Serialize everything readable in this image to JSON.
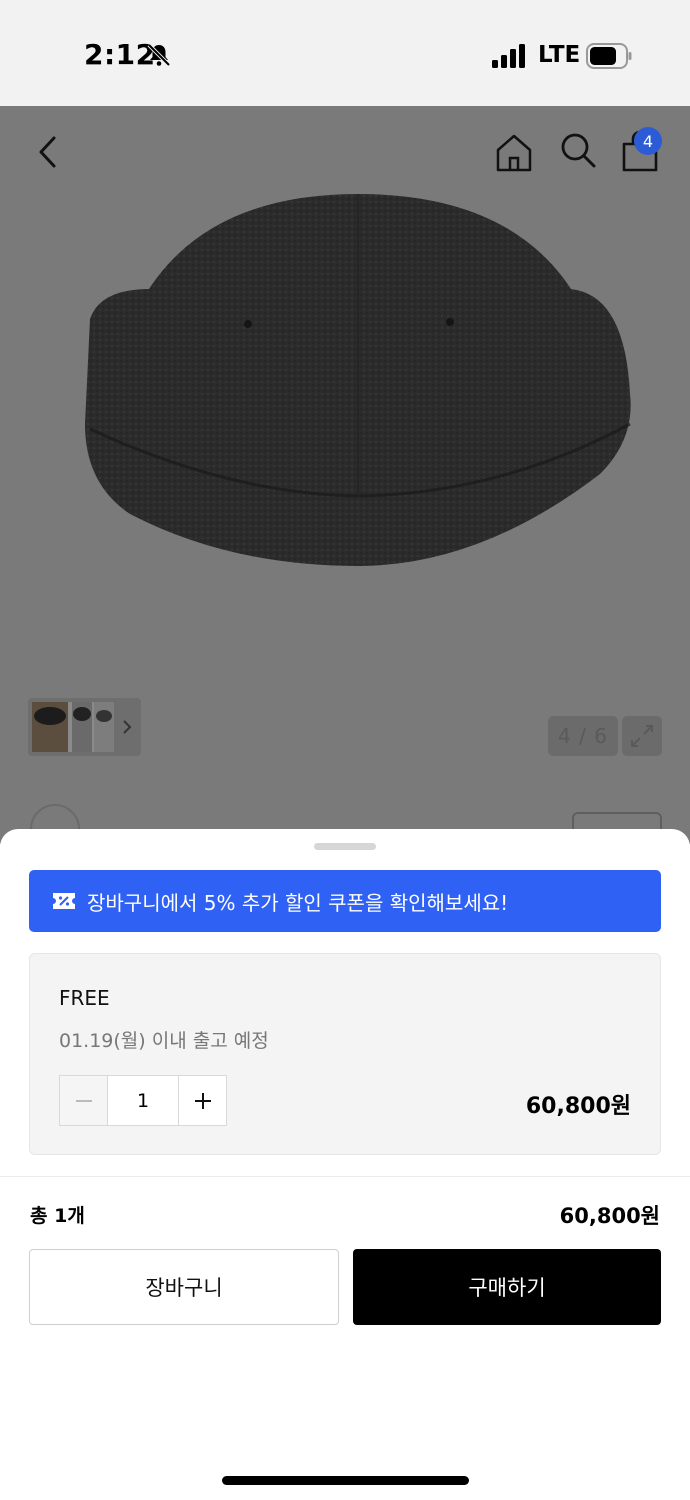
{
  "status_bar": {
    "time": "2:12",
    "network": "LTE",
    "icons": [
      "bell-slash-icon",
      "signal-icon",
      "battery-icon"
    ]
  },
  "top_nav": {
    "icons": [
      "back-icon",
      "home-icon",
      "search-icon",
      "cart-icon"
    ],
    "cart_badge": "4",
    "badge_color": "#2c5bd6"
  },
  "gallery": {
    "page_counter": "4 / 6",
    "icons": [
      "chevron-right-icon",
      "expand-icon"
    ]
  },
  "coupon": {
    "text": "장바구니에서 5% 추가 할인 쿠폰을 확인해보세요!",
    "color": "#2f61f5",
    "icon": "coupon-icon"
  },
  "option": {
    "name": "FREE",
    "shipping": "01.19(월) 이내 출고 예정",
    "quantity": "1",
    "price": "60,800원"
  },
  "total": {
    "label": "총 1개",
    "price": "60,800원"
  },
  "actions": {
    "cart_label": "장바구니",
    "buy_label": "구매하기"
  }
}
